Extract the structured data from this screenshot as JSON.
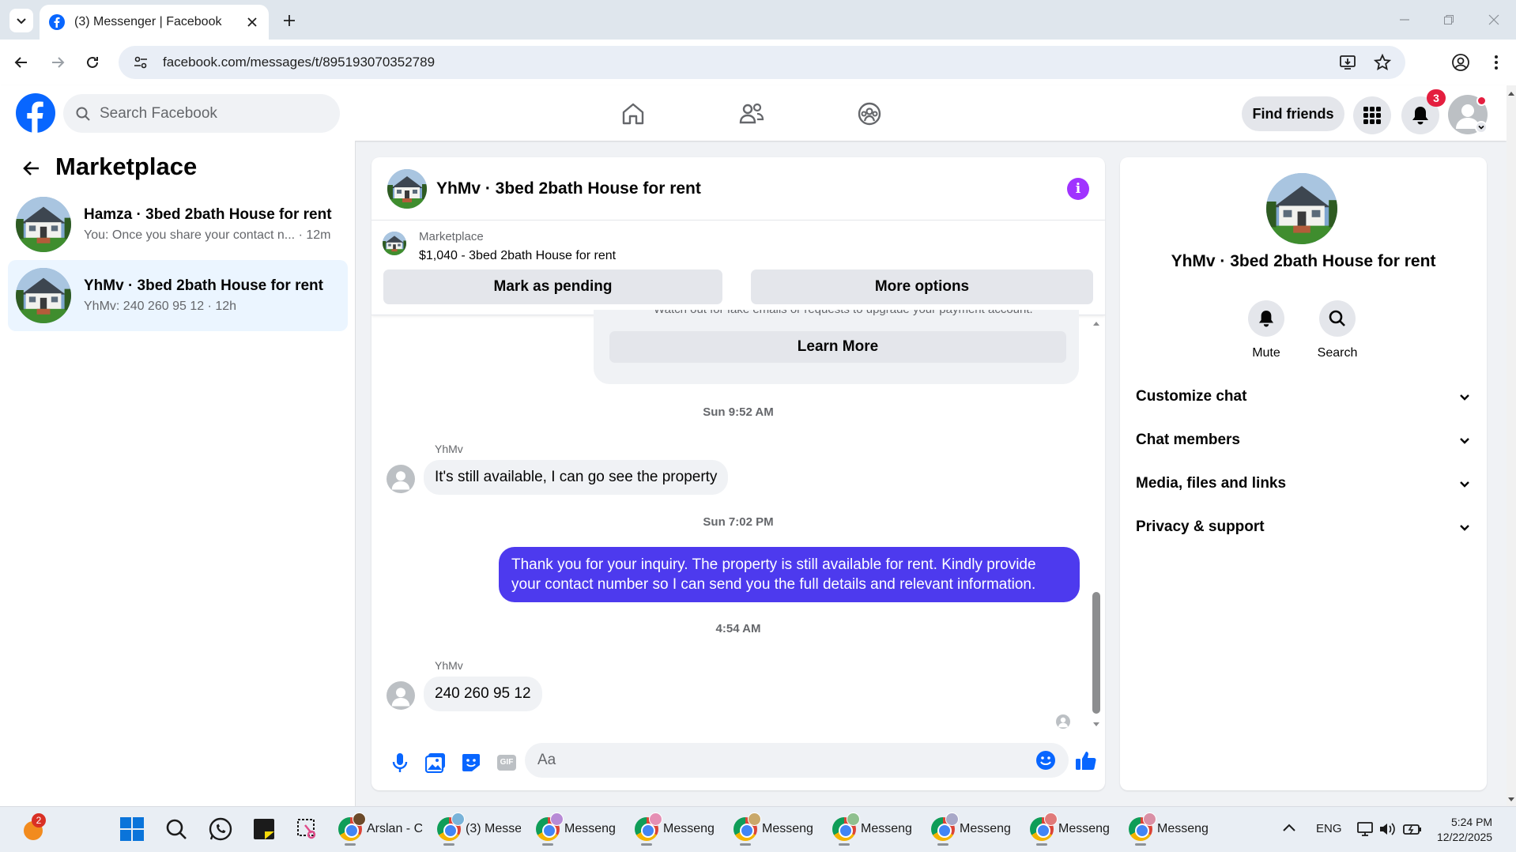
{
  "browser": {
    "tab_title": "(3) Messenger | Facebook",
    "url": "facebook.com/messages/t/895193070352789"
  },
  "fb_header": {
    "search_placeholder": "Search Facebook",
    "find_friends": "Find friends",
    "notification_count": "3"
  },
  "sidebar": {
    "title": "Marketplace",
    "conversations": [
      {
        "title": "Hamza · 3bed 2bath House for rent",
        "preview": "You: Once you share your contact n...",
        "time": "12m",
        "active": false
      },
      {
        "title": "YhMv · 3bed 2bath House for rent",
        "preview": "YhMv: 240 260 95 12",
        "time": "12h",
        "active": true
      }
    ]
  },
  "chat": {
    "title": "YhMv · 3bed 2bath House for rent",
    "marketplace_label": "Marketplace",
    "listing": "$1,040 - 3bed 2bath House for rent",
    "mark_pending": "Mark as pending",
    "more_options": "More options",
    "warning_partial": "Watch out for fake emails or requests to upgrade your payment account.",
    "learn_more": "Learn More",
    "messages": [
      {
        "time": "Sun 9:52 AM",
        "sender": "YhMv",
        "text": "It's still available, I can go see the property",
        "outgoing": false
      },
      {
        "time": "Sun 7:02 PM",
        "sender": "",
        "text": "Thank you for your inquiry. The property is still available for rent. Kindly provide your contact number so I can send you the full details and relevant information.",
        "outgoing": true
      },
      {
        "time": "4:54 AM",
        "sender": "YhMv",
        "text": "240 260 95 12",
        "outgoing": false
      }
    ],
    "composer_placeholder": "Aa",
    "gif_label": "GIF"
  },
  "info_panel": {
    "title": "YhMv · 3bed 2bath House for rent",
    "actions": [
      {
        "label": "Mute",
        "icon": "bell-icon"
      },
      {
        "label": "Search",
        "icon": "search-icon"
      }
    ],
    "sections": [
      "Customize chat",
      "Chat members",
      "Media, files and links",
      "Privacy & support"
    ]
  },
  "taskbar": {
    "weather_badge": "2",
    "apps": [
      "Arslan - C",
      "(3) Messe",
      "Messeng",
      "Messeng",
      "Messeng",
      "Messeng",
      "Messeng",
      "Messeng",
      "Messeng"
    ],
    "language": "ENG",
    "time": "5:24 PM",
    "date": "12/22/2025"
  },
  "colors": {
    "fb_blue": "#0866ff",
    "outgoing_bubble": "#4d3aee",
    "active_conv_bg": "#ebf5ff",
    "info_purple": "#a033ff",
    "badge_red": "#e41e3f"
  }
}
